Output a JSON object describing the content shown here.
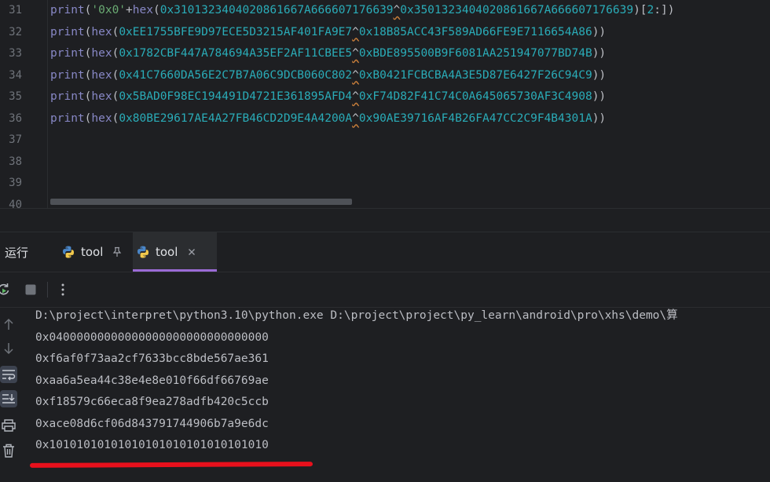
{
  "editor": {
    "line_numbers": [
      "31",
      "32",
      "33",
      "34",
      "35",
      "36",
      "37",
      "38",
      "39",
      "40"
    ],
    "lines": [
      {
        "parts": [
          {
            "t": "print",
            "c": "tok-builtin"
          },
          {
            "t": "(",
            "c": "tok-paren"
          },
          {
            "t": "'0x0'",
            "c": "tok-str"
          },
          {
            "t": "+",
            "c": "tok-op"
          },
          {
            "t": "hex",
            "c": "tok-builtin"
          },
          {
            "t": "(",
            "c": "tok-paren"
          },
          {
            "t": "0x3101323404020861667A666607176639",
            "c": "tok-num"
          },
          {
            "t": "^",
            "c": "tok-xor"
          },
          {
            "t": "0x3501323404020861667A666607176639",
            "c": "tok-num"
          },
          {
            "t": ")[",
            "c": "tok-paren"
          },
          {
            "t": "2",
            "c": "tok-num"
          },
          {
            "t": ":])",
            "c": "tok-paren"
          }
        ]
      },
      {
        "parts": [
          {
            "t": "print",
            "c": "tok-builtin"
          },
          {
            "t": "(",
            "c": "tok-paren"
          },
          {
            "t": "hex",
            "c": "tok-builtin"
          },
          {
            "t": "(",
            "c": "tok-paren"
          },
          {
            "t": "0xEE1755BFE9D97ECE5D3215AF401FA9E7",
            "c": "tok-num"
          },
          {
            "t": "^",
            "c": "tok-xor"
          },
          {
            "t": "0x18B85ACC43F589AD66FE9E7116654A86",
            "c": "tok-num"
          },
          {
            "t": "))",
            "c": "tok-paren"
          }
        ]
      },
      {
        "parts": [
          {
            "t": "print",
            "c": "tok-builtin"
          },
          {
            "t": "(",
            "c": "tok-paren"
          },
          {
            "t": "hex",
            "c": "tok-builtin"
          },
          {
            "t": "(",
            "c": "tok-paren"
          },
          {
            "t": "0x1782CBF447A784694A35EF2AF11CBEE5",
            "c": "tok-num"
          },
          {
            "t": "^",
            "c": "tok-xor"
          },
          {
            "t": "0xBDE895500B9F6081AA251947077BD74B",
            "c": "tok-num"
          },
          {
            "t": "))",
            "c": "tok-paren"
          }
        ]
      },
      {
        "parts": [
          {
            "t": "print",
            "c": "tok-builtin"
          },
          {
            "t": "(",
            "c": "tok-paren"
          },
          {
            "t": "hex",
            "c": "tok-builtin"
          },
          {
            "t": "(",
            "c": "tok-paren"
          },
          {
            "t": "0x41C7660DA56E2C7B7A06C9DCB060C802",
            "c": "tok-num"
          },
          {
            "t": "^",
            "c": "tok-xor"
          },
          {
            "t": "0xB0421FCBCBA4A3E5D87E6427F26C94C9",
            "c": "tok-num"
          },
          {
            "t": "))",
            "c": "tok-paren"
          }
        ]
      },
      {
        "parts": [
          {
            "t": "print",
            "c": "tok-builtin"
          },
          {
            "t": "(",
            "c": "tok-paren"
          },
          {
            "t": "hex",
            "c": "tok-builtin"
          },
          {
            "t": "(",
            "c": "tok-paren"
          },
          {
            "t": "0x5BAD0F98EC194491D4721E361895AFD4",
            "c": "tok-num"
          },
          {
            "t": "^",
            "c": "tok-xor"
          },
          {
            "t": "0xF74D82F41C74C0A645065730AF3C4908",
            "c": "tok-num"
          },
          {
            "t": "))",
            "c": "tok-paren"
          }
        ]
      },
      {
        "parts": [
          {
            "t": "print",
            "c": "tok-builtin"
          },
          {
            "t": "(",
            "c": "tok-paren"
          },
          {
            "t": "hex",
            "c": "tok-builtin"
          },
          {
            "t": "(",
            "c": "tok-paren"
          },
          {
            "t": "0x80BE29617AE4A27FB46CD2D9E4A4200A",
            "c": "tok-num"
          },
          {
            "t": "^",
            "c": "tok-xor"
          },
          {
            "t": "0x90AE39716AF4B26FA47CC2C9F4B4301A",
            "c": "tok-num"
          },
          {
            "t": "))",
            "c": "tok-paren"
          }
        ]
      }
    ]
  },
  "run_panel": {
    "title": "运行",
    "tabs": [
      {
        "label": "tool",
        "pinned": true,
        "active": false
      },
      {
        "label": "tool",
        "pinned": false,
        "active": true
      }
    ]
  },
  "console": {
    "lines": [
      "D:\\project\\interpret\\python3.10\\python.exe D:\\project\\project\\py_learn\\android\\pro\\xhs\\demo\\算",
      "0x04000000000000000000000000000000",
      "0xf6af0f73aa2cf7633bcc8bde567ae361",
      "0xaa6a5ea44c38e4e8e010f66df66769ae",
      "0xf18579c66eca8f9ea278adfb420c5ccb",
      "0xace08d6cf06d843791744906b7a9e6dc",
      "0x10101010101010101010101010101010"
    ]
  },
  "colors": {
    "background": "#1e1f22",
    "active_tab_underline": "#9b6bd6",
    "annotation_red": "#e8101c"
  }
}
